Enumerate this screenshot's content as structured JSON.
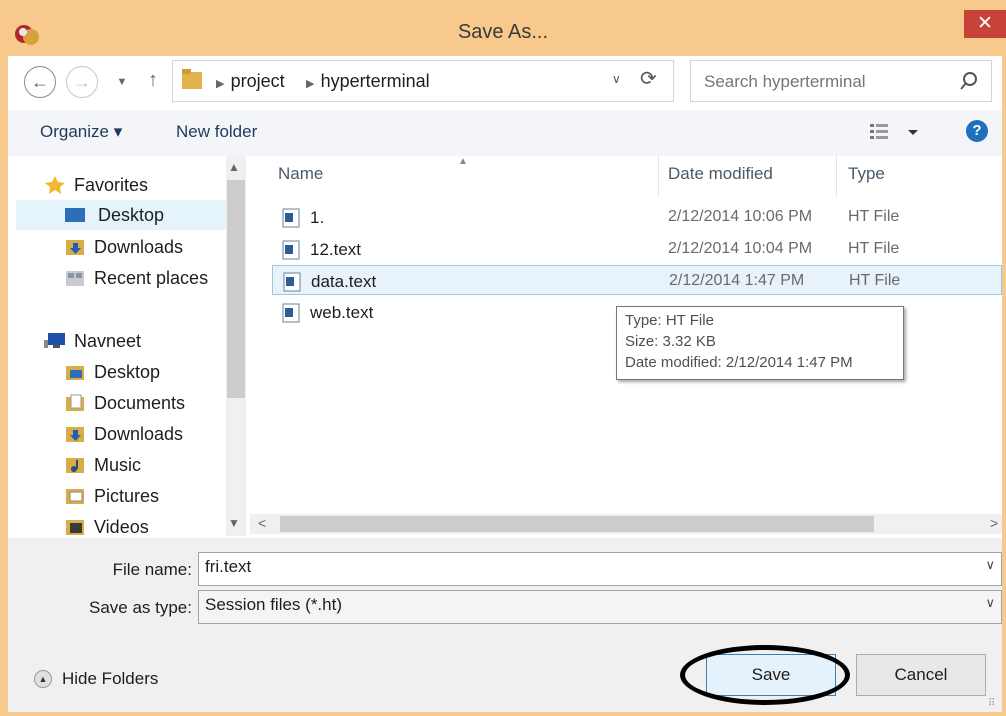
{
  "window": {
    "title": "Save As...",
    "close_label": "✕"
  },
  "nav": {
    "back": "←",
    "forward": "→",
    "recent": "▼",
    "up": "↑",
    "breadcrumbs": [
      "project",
      "hyperterminal"
    ],
    "address_dropdown": "∨",
    "refresh": "⟳",
    "search_placeholder": "Search hyperterminal"
  },
  "toolbar": {
    "organize": "Organize ▾",
    "new_folder": "New folder",
    "help": "?"
  },
  "sidebar": {
    "groups": [
      {
        "label": "Favorites",
        "icon": "star-icon",
        "items": [
          {
            "label": "Desktop",
            "icon": "desktop-icon",
            "selected": true
          },
          {
            "label": "Downloads",
            "icon": "downloads-icon"
          },
          {
            "label": "Recent places",
            "icon": "recent-places-icon"
          }
        ]
      },
      {
        "label": "Navneet",
        "icon": "computer-icon",
        "items": [
          {
            "label": "Desktop",
            "icon": "desktop-folder-icon"
          },
          {
            "label": "Documents",
            "icon": "documents-icon"
          },
          {
            "label": "Downloads",
            "icon": "downloads-icon"
          },
          {
            "label": "Music",
            "icon": "music-icon"
          },
          {
            "label": "Pictures",
            "icon": "pictures-icon"
          },
          {
            "label": "Videos",
            "icon": "videos-icon"
          }
        ]
      }
    ]
  },
  "files": {
    "columns": [
      "Name",
      "Date modified",
      "Type"
    ],
    "rows": [
      {
        "name": "1.",
        "date": "2/12/2014 10:06 PM",
        "type": "HT File"
      },
      {
        "name": "12.text",
        "date": "2/12/2014 10:04 PM",
        "type": "HT File"
      },
      {
        "name": "data.text",
        "date": "2/12/2014 1:47 PM",
        "type": "HT File",
        "selected": true
      },
      {
        "name": "web.text",
        "date": "",
        "type": ""
      }
    ],
    "tooltip": [
      "Type: HT File",
      "Size: 3.32 KB",
      "Date modified: 2/12/2014 1:47 PM"
    ]
  },
  "form": {
    "file_name_label": "File name:",
    "file_name_value": "fri.text",
    "save_type_label": "Save as type:",
    "save_type_value": "Session files (*.ht)"
  },
  "footer": {
    "hide_folders": "Hide Folders",
    "save": "Save",
    "cancel": "Cancel"
  },
  "colors": {
    "titlebar": "#f7c98d",
    "close": "#c8423a",
    "selection": "#e5f3fb",
    "link": "#1e3a5f"
  }
}
